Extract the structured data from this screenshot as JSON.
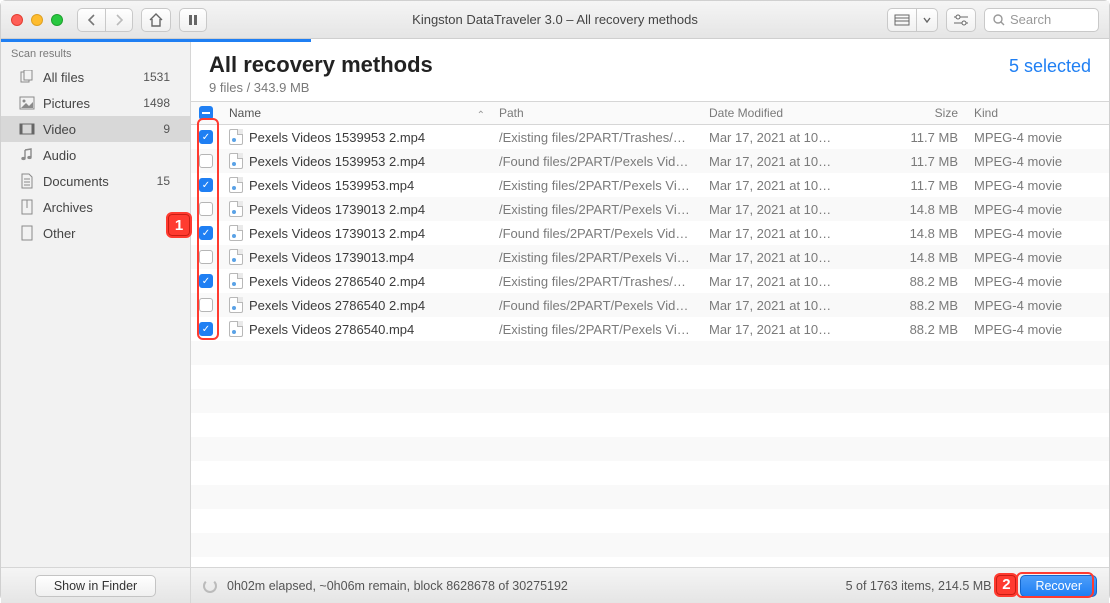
{
  "window": {
    "title": "Kingston DataTraveler 3.0 – All recovery methods",
    "search_placeholder": "Search"
  },
  "sidebar": {
    "header": "Scan results",
    "show_in_finder": "Show in Finder",
    "items": [
      {
        "icon": "files",
        "label": "All files",
        "count": "1531"
      },
      {
        "icon": "pictures",
        "label": "Pictures",
        "count": "1498"
      },
      {
        "icon": "video",
        "label": "Video",
        "count": "9",
        "selected": true
      },
      {
        "icon": "audio",
        "label": "Audio",
        "count": ""
      },
      {
        "icon": "document",
        "label": "Documents",
        "count": "15"
      },
      {
        "icon": "archive",
        "label": "Archives",
        "count": ""
      },
      {
        "icon": "other",
        "label": "Other",
        "count": ""
      }
    ]
  },
  "header": {
    "title": "All recovery methods",
    "subtitle": "9 files / 343.9 MB",
    "selected": "5 selected"
  },
  "columns": {
    "name": "Name",
    "path": "Path",
    "date": "Date Modified",
    "size": "Size",
    "kind": "Kind"
  },
  "rows": [
    {
      "checked": true,
      "name": "Pexels Videos 1539953 2.mp4",
      "path": "/Existing files/2PART/Trashes/5…",
      "date": "Mar 17, 2021 at 10:…",
      "size": "11.7 MB",
      "kind": "MPEG-4 movie"
    },
    {
      "checked": false,
      "name": "Pexels Videos 1539953 2.mp4",
      "path": "/Found files/2PART/Pexels Vide…",
      "date": "Mar 17, 2021 at 10:…",
      "size": "11.7 MB",
      "kind": "MPEG-4 movie"
    },
    {
      "checked": true,
      "name": "Pexels Videos 1539953.mp4",
      "path": "/Existing files/2PART/Pexels Vid…",
      "date": "Mar 17, 2021 at 10:…",
      "size": "11.7 MB",
      "kind": "MPEG-4 movie"
    },
    {
      "checked": false,
      "name": "Pexels Videos 1739013 2.mp4",
      "path": "/Existing files/2PART/Pexels Vid…",
      "date": "Mar 17, 2021 at 10:…",
      "size": "14.8 MB",
      "kind": "MPEG-4 movie"
    },
    {
      "checked": true,
      "name": "Pexels Videos 1739013 2.mp4",
      "path": "/Found files/2PART/Pexels Vide…",
      "date": "Mar 17, 2021 at 10:…",
      "size": "14.8 MB",
      "kind": "MPEG-4 movie"
    },
    {
      "checked": false,
      "name": "Pexels Videos 1739013.mp4",
      "path": "/Existing files/2PART/Pexels Vid…",
      "date": "Mar 17, 2021 at 10:…",
      "size": "14.8 MB",
      "kind": "MPEG-4 movie"
    },
    {
      "checked": true,
      "name": "Pexels Videos 2786540 2.mp4",
      "path": "/Existing files/2PART/Trashes/5…",
      "date": "Mar 17, 2021 at 10:…",
      "size": "88.2 MB",
      "kind": "MPEG-4 movie"
    },
    {
      "checked": false,
      "name": "Pexels Videos 2786540 2.mp4",
      "path": "/Found files/2PART/Pexels Vide…",
      "date": "Mar 17, 2021 at 10:…",
      "size": "88.2 MB",
      "kind": "MPEG-4 movie"
    },
    {
      "checked": true,
      "name": "Pexels Videos 2786540.mp4",
      "path": "/Existing files/2PART/Pexels Vid…",
      "date": "Mar 17, 2021 at 10:…",
      "size": "88.2 MB",
      "kind": "MPEG-4 movie"
    }
  ],
  "status": {
    "progress": "0h02m elapsed, ~0h06m remain, block 8628678 of 30275192",
    "summary": "5 of 1763 items, 214.5 MB t",
    "recover": "Recover"
  },
  "annot": {
    "one": "1",
    "two": "2"
  }
}
